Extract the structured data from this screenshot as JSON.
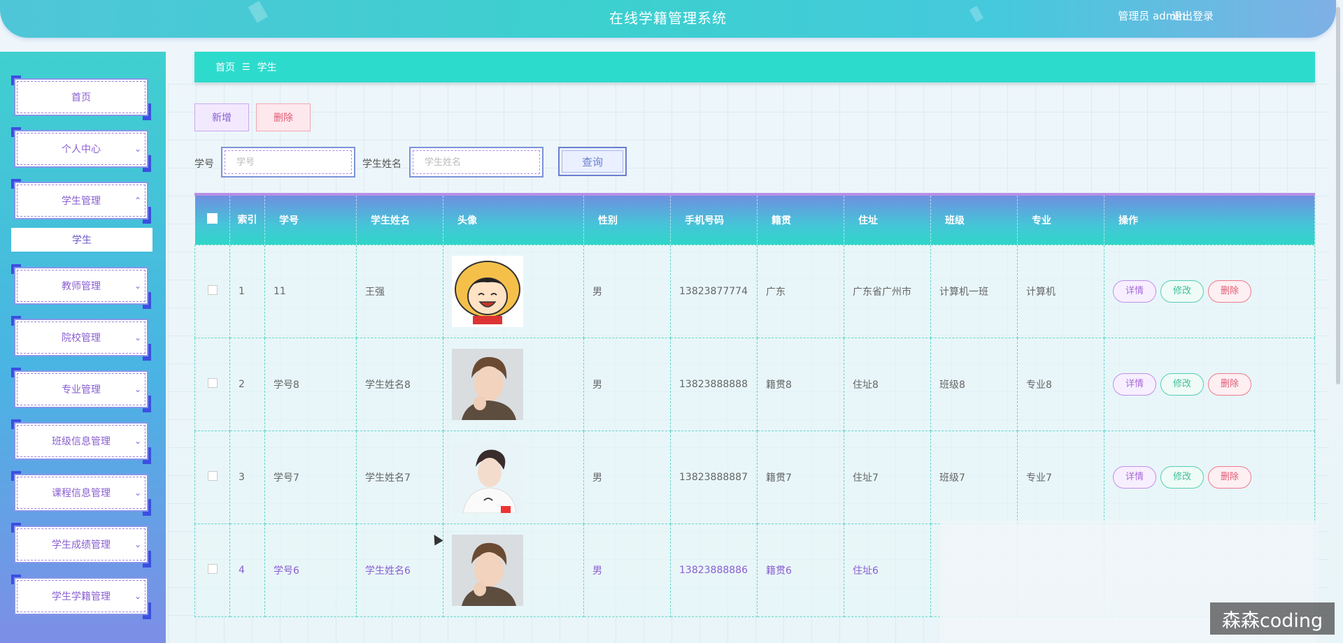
{
  "header": {
    "title": "在线学籍管理系统",
    "user": "管理员 admin",
    "logout": "退出登录"
  },
  "sidebar": {
    "items": [
      {
        "label": "首页",
        "expandable": false
      },
      {
        "label": "个人中心",
        "expandable": true
      },
      {
        "label": "学生管理",
        "expandable": true,
        "expanded": true
      },
      {
        "label": "教师管理",
        "expandable": true
      },
      {
        "label": "院校管理",
        "expandable": true
      },
      {
        "label": "专业管理",
        "expandable": true
      },
      {
        "label": "班级信息管理",
        "expandable": true
      },
      {
        "label": "课程信息管理",
        "expandable": true
      },
      {
        "label": "学生成绩管理",
        "expandable": true
      },
      {
        "label": "学生学籍管理",
        "expandable": true
      }
    ],
    "sub_item": "学生"
  },
  "breadcrumb": {
    "home": "首页",
    "separator": "☰",
    "current": "学生"
  },
  "toolbar": {
    "add_label": "新增",
    "delete_label": "删除"
  },
  "search": {
    "student_no_label": "学号",
    "student_no_placeholder": "学号",
    "student_name_label": "学生姓名",
    "student_name_placeholder": "学生姓名",
    "query_label": "查询"
  },
  "table": {
    "headers": {
      "index": "索引",
      "student_no": "学号",
      "student_name": "学生姓名",
      "avatar": "头像",
      "gender": "性别",
      "phone": "手机号码",
      "native_place": "籍贯",
      "address": "住址",
      "class": "班级",
      "major": "专业",
      "operation": "操作"
    },
    "rows": [
      {
        "index": "1",
        "student_no": "11",
        "student_name": "王强",
        "gender": "男",
        "phone": "13823877774",
        "native_place": "广东",
        "address": "广东省广州市",
        "class": "计算机一班",
        "major": "计算机",
        "avatar": "cartoon-avatar"
      },
      {
        "index": "2",
        "student_no": "学号8",
        "student_name": "学生姓名8",
        "gender": "男",
        "phone": "13823888888",
        "native_place": "籍贯8",
        "address": "住址8",
        "class": "班级8",
        "major": "专业8",
        "avatar": "photo-avatar"
      },
      {
        "index": "3",
        "student_no": "学号7",
        "student_name": "学生姓名7",
        "gender": "男",
        "phone": "13823888887",
        "native_place": "籍贯7",
        "address": "住址7",
        "class": "班级7",
        "major": "专业7",
        "avatar": "photo-avatar"
      },
      {
        "index": "4",
        "student_no": "学号6",
        "student_name": "学生姓名6",
        "gender": "男",
        "phone": "13823888886",
        "native_place": "籍贯6",
        "address": "住址6",
        "class": "",
        "major": "",
        "avatar": "photo-avatar"
      }
    ],
    "actions": {
      "detail": "详情",
      "edit": "修改",
      "delete": "删除"
    }
  },
  "watermark": "森森coding",
  "colors": {
    "accent_teal": "#2ddbcc",
    "accent_purple": "#8a5fd0",
    "danger": "#e35a73",
    "success": "#3fbf9a"
  }
}
